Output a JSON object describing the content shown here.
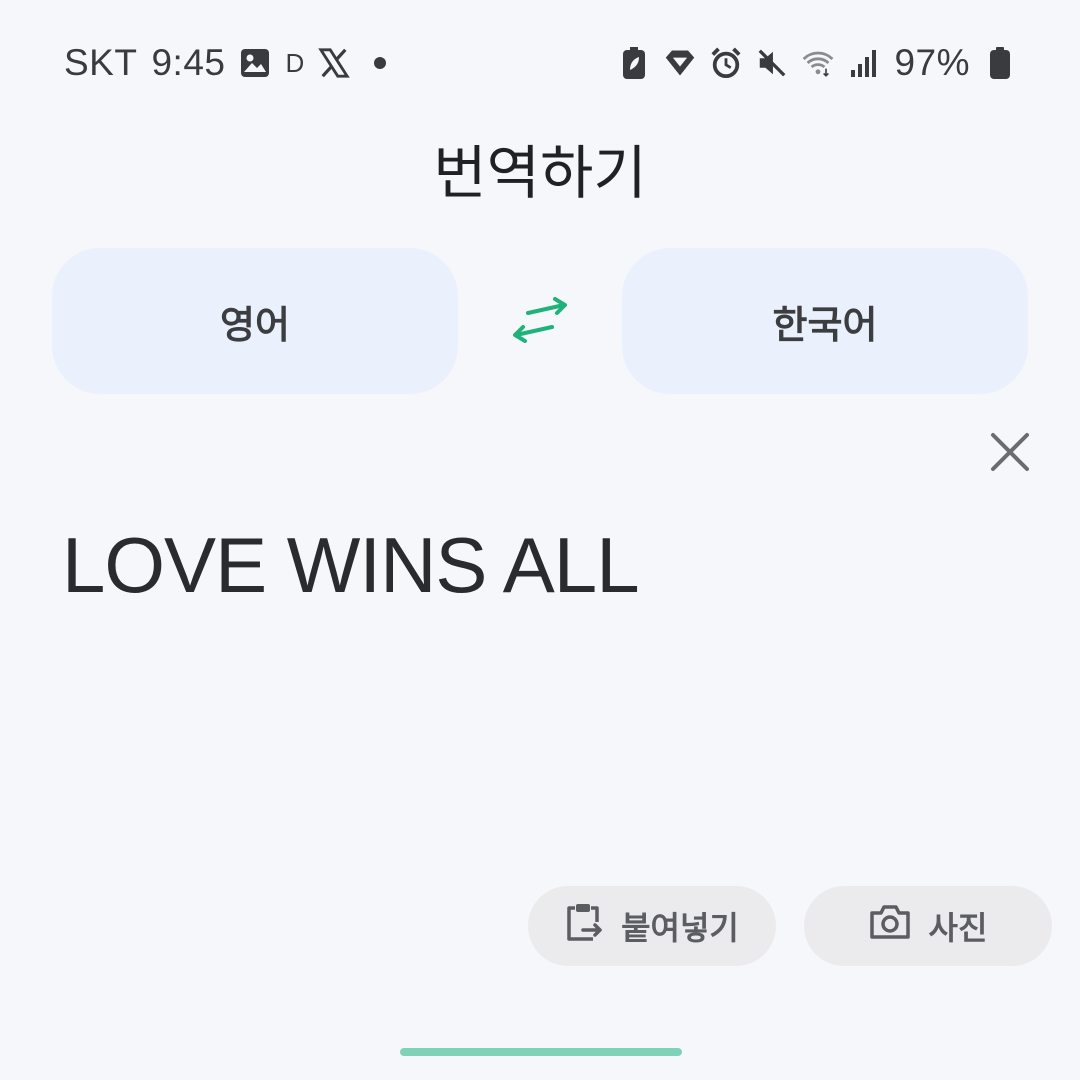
{
  "status_bar": {
    "carrier": "SKT",
    "time": "9:45",
    "notification_letter": "D",
    "battery": "97%",
    "icons": [
      "image-icon",
      "x-app-icon",
      "dot-icon",
      "battery-saver-icon",
      "diamond-icon",
      "alarm-icon",
      "mute-icon",
      "wifi-icon",
      "signal-icon",
      "battery-icon"
    ]
  },
  "page": {
    "title": "번역하기"
  },
  "languages": {
    "source": "영어",
    "target": "한국어",
    "swap_icon": "swap-arrows-icon",
    "swap_color": "#1fb27a"
  },
  "input": {
    "text": "LOVE WINS ALL",
    "clear_icon": "close-icon"
  },
  "actions": {
    "paste_label": "붙여넣기",
    "photo_label": "사진"
  },
  "colors": {
    "background": "#f6f7fb",
    "language_button": "#eaf1fd",
    "action_button": "#ebebed",
    "home_indicator": "#7fd1b8"
  }
}
